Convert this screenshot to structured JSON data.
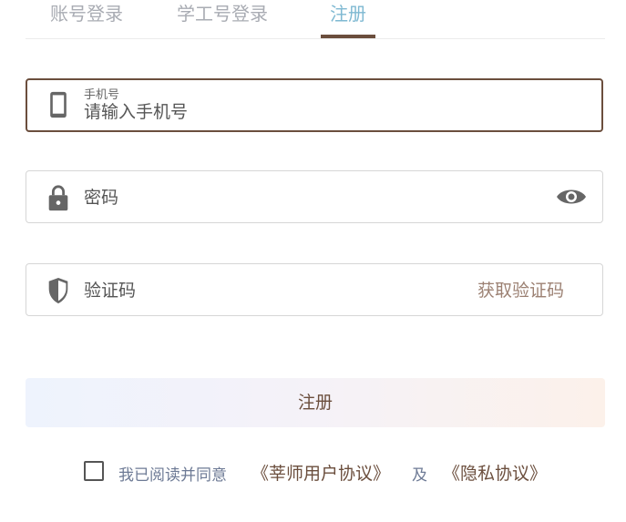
{
  "tabs": [
    {
      "label": "账号登录"
    },
    {
      "label": "学工号登录"
    },
    {
      "label": "注册"
    }
  ],
  "active_tab": "注册",
  "colors": {
    "accent": "#6b4e3d",
    "active_tab": "#7fb9d2",
    "inactive_tab": "#a9acb3",
    "link_muted": "#6d7a95",
    "code_button": "#9c8173"
  },
  "phone_field": {
    "label": "手机号",
    "placeholder": "请输入手机号",
    "icon": "phone-icon"
  },
  "password_field": {
    "placeholder": "密码",
    "icon": "lock-icon",
    "toggle_icon": "eye-icon"
  },
  "code_field": {
    "placeholder": "验证码",
    "icon": "shield-icon",
    "get_code_label": "获取验证码"
  },
  "register_button": {
    "label": "注册"
  },
  "agreement": {
    "prefix": "我已阅读并同意",
    "user_agreement": "《莘师用户协议》",
    "conjunction": "及",
    "privacy_agreement": "《隐私协议》"
  }
}
